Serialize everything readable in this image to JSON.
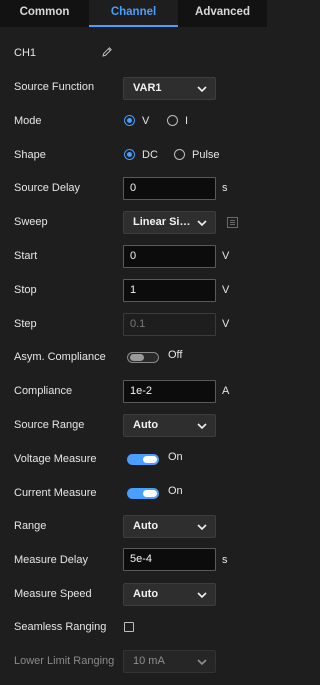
{
  "tabs": [
    {
      "label": "Common",
      "active": false
    },
    {
      "label": "Channel",
      "active": true
    },
    {
      "label": "Advanced",
      "active": false
    }
  ],
  "accent_color": "#4a9eff",
  "channel": {
    "name": "CH1",
    "edit_icon": "pencil-icon"
  },
  "source_function": {
    "label": "Source Function",
    "value": "VAR1"
  },
  "mode": {
    "label": "Mode",
    "options": [
      "V",
      "I"
    ],
    "selected": "V"
  },
  "shape": {
    "label": "Shape",
    "options": [
      "DC",
      "Pulse"
    ],
    "selected": "DC"
  },
  "source_delay": {
    "label": "Source Delay",
    "value": "0",
    "unit": "s"
  },
  "sweep": {
    "label": "Sweep",
    "value": "Linear Sing...",
    "settings_icon": "grid-settings-icon"
  },
  "start": {
    "label": "Start",
    "value": "0",
    "unit": "V"
  },
  "stop": {
    "label": "Stop",
    "value": "1",
    "unit": "V"
  },
  "step": {
    "label": "Step",
    "value": "0.1",
    "unit": "V"
  },
  "asym_compliance": {
    "label": "Asym. Compliance",
    "state": "Off"
  },
  "compliance": {
    "label": "Compliance",
    "value": "1e-2",
    "unit": "A"
  },
  "source_range": {
    "label": "Source Range",
    "value": "Auto"
  },
  "voltage_measure": {
    "label": "Voltage Measure",
    "state": "On"
  },
  "current_measure": {
    "label": "Current Measure",
    "state": "On"
  },
  "range": {
    "label": "Range",
    "value": "Auto"
  },
  "measure_delay": {
    "label": "Measure Delay",
    "value": "5e-4",
    "unit": "s"
  },
  "measure_speed": {
    "label": "Measure Speed",
    "value": "Auto"
  },
  "seamless_ranging": {
    "label": "Seamless Ranging",
    "checked": false
  },
  "lower_limit_ranging": {
    "label": "Lower Limit Ranging",
    "value": "10 mA"
  }
}
